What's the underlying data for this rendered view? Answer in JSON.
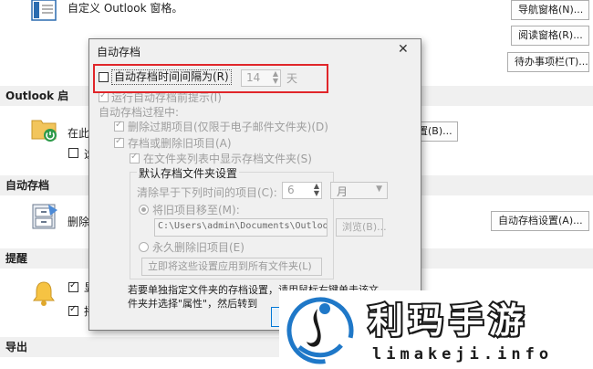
{
  "page": {
    "nav_pane_text": "自定义 Outlook 窗格。",
    "buttons": {
      "navigation_pane": "导航窗格(N)...",
      "reading_pane": "阅读窗格(R)...",
      "todo_bar": "待办事项栏(T)...",
      "archive_settings": "自动存档设置(A)...",
      "obscured_settings": "置(B)..."
    },
    "sections": {
      "outlook_start": "Outlook 启",
      "autoarchive": "自动存档",
      "reminders": "提醒",
      "export": "导出"
    },
    "partial_labels": {
      "start_row1": "在此",
      "start_row2": "选",
      "archive_row": "删除",
      "reminder_row1": "显",
      "reminder_row2": "播"
    }
  },
  "dialog": {
    "title": "自动存档",
    "close_glyph": "✕",
    "interval_label": "自动存档时间间隔为(R)",
    "interval_value": "14",
    "interval_unit": "天",
    "prompt_label": "运行自动存档前提示(I)",
    "during_label": "自动存档过程中:",
    "delete_expired_label": "删除过期项目(仅限于电子邮件文件夹)(D)",
    "archive_or_delete_label": "存档或删除旧项目(A)",
    "show_folder_label": "在文件夹列表中显示存档文件夹(S)",
    "default_group_title": "默认存档文件夹设置",
    "clean_older_label": "清除早于下列时间的项目(C):",
    "clean_older_value": "6",
    "clean_older_unit": "月",
    "move_old_label": "将旧项目移至(M):",
    "path_value": "C:\\Users\\admin\\Documents\\Outloo",
    "browse_label": "浏览(B)...",
    "delete_permanent_label": "永久删除旧项目(E)",
    "apply_all_label": "立即将这些设置应用到所有文件夹(L)",
    "footer_text_1": "若要单独指定文件夹的存档设置，请用鼠标右键单击该文",
    "footer_text_2": "件夹并选择\"属性\"，然后转到"
  },
  "watermark": {
    "title": "利玛手游",
    "url": "limakeji.info",
    "colors": {
      "blue": "#1f78c8",
      "dark": "#1a1a1a",
      "bg": "#ffffff"
    }
  }
}
